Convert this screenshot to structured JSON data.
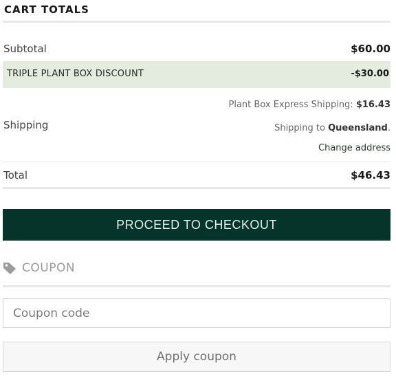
{
  "cart_totals": {
    "title": "CART TOTALS",
    "subtotal_label": "Subtotal",
    "subtotal_value": "$60.00",
    "discount_label": "TRIPLE PLANT BOX DISCOUNT",
    "discount_value": "-$30.00",
    "shipping_label": "Shipping",
    "shipping_method": "Plant Box Express Shipping:",
    "shipping_cost": "$16.43",
    "shipping_to_prefix": "Shipping to",
    "shipping_to_region": "Queensland",
    "shipping_to_suffix": ".",
    "change_address": "Change address",
    "total_label": "Total",
    "total_value": "$46.43"
  },
  "checkout": {
    "button_label": "PROCEED TO CHECKOUT",
    "color": "#05352a"
  },
  "coupon": {
    "heading": "COUPON",
    "icon": "tag-icon",
    "input_placeholder": "Coupon code",
    "apply_label": "Apply coupon"
  }
}
